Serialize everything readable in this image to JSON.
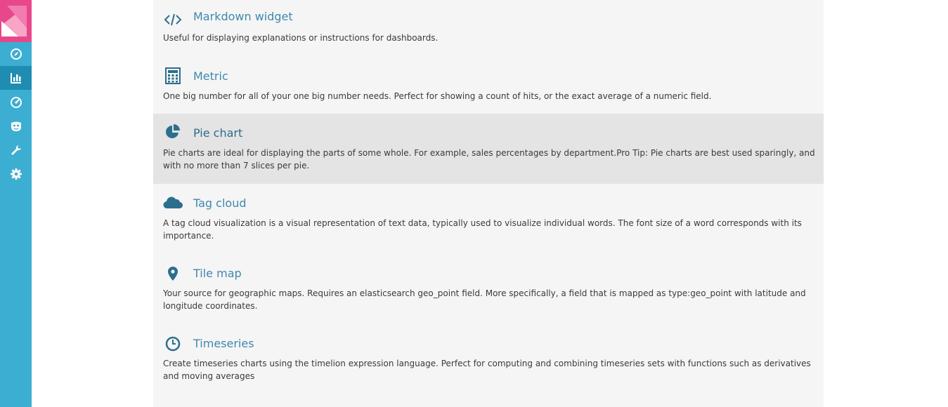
{
  "colors": {
    "sidebar": "#3caed2",
    "sidebar_active": "#1f8cb1",
    "logo": "#e8478b",
    "title": "#3f88ad",
    "icon": "#2c6f8d",
    "panel": "#f5f5f5",
    "hover": "#e4e4e4"
  },
  "sidebar": {
    "items": [
      {
        "icon": "compass-icon"
      },
      {
        "icon": "bar-chart-icon",
        "active": true
      },
      {
        "icon": "dashboard-gauge-icon"
      },
      {
        "icon": "timelion-mask-icon"
      },
      {
        "icon": "wrench-icon"
      },
      {
        "icon": "gear-icon"
      }
    ]
  },
  "visualizations": [
    {
      "icon": "code-icon",
      "title": "Markdown widget",
      "description": "Useful for displaying explanations or instructions for dashboards."
    },
    {
      "icon": "calculator-icon",
      "title": "Metric",
      "description": "One big number for all of your one big number needs. Perfect for showing a count of hits, or the exact average of a numeric field."
    },
    {
      "icon": "pie-chart-icon",
      "title": "Pie chart",
      "description": "Pie charts are ideal for displaying the parts of some whole. For example, sales percentages by department.Pro Tip: Pie charts are best used sparingly, and with no more than 7 slices per pie.",
      "hovered": true
    },
    {
      "icon": "cloud-icon",
      "title": "Tag cloud",
      "description": "A tag cloud visualization is a visual representation of text data, typically used to visualize individual words. The font size of a word corresponds with its importance."
    },
    {
      "icon": "map-marker-icon",
      "title": "Tile map",
      "description": "Your source for geographic maps. Requires an elasticsearch geo_point field. More specifically, a field that is mapped as type:geo_point with latitude and longitude coordinates."
    },
    {
      "icon": "clock-icon",
      "title": "Timeseries",
      "description": "Create timeseries charts using the timelion expression language. Perfect for computing and combining timeseries sets with functions such as derivatives and moving averages"
    }
  ]
}
